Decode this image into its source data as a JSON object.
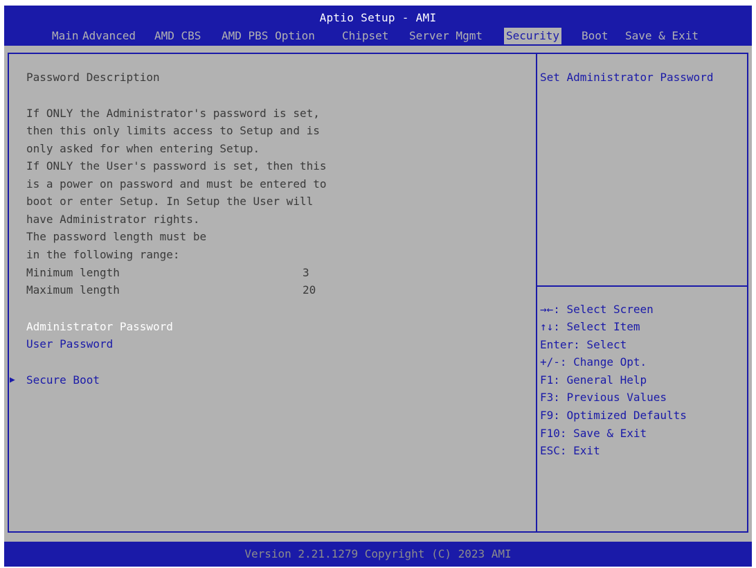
{
  "header": {
    "title": "Aptio Setup - AMI",
    "tabs": [
      {
        "label": "Main"
      },
      {
        "label": "Advanced"
      },
      {
        "label": "AMD CBS"
      },
      {
        "label": "AMD PBS Option"
      },
      {
        "label": "Chipset"
      },
      {
        "label": "Server Mgmt"
      },
      {
        "label": "Security",
        "active": true
      },
      {
        "label": "Boot"
      },
      {
        "label": "Save & Exit"
      }
    ]
  },
  "main": {
    "description_title": "Password Description",
    "description_lines": [
      "If ONLY the Administrator's password is set,",
      "then this only limits access to Setup and is",
      "only asked for when entering Setup.",
      "If ONLY the User's password is set, then this",
      "is a power on password and must be entered to",
      "boot or enter Setup. In Setup the User will",
      "have Administrator rights.",
      "The password length must be",
      "in the following range:"
    ],
    "min_length_label": "Minimum length",
    "min_length_value": "3",
    "max_length_label": "Maximum length",
    "max_length_value": "20",
    "items": [
      {
        "label": "Administrator Password",
        "selected": true
      },
      {
        "label": "User Password"
      },
      {
        "label": "Secure Boot",
        "submenu": true
      }
    ]
  },
  "help": {
    "item_help": "Set Administrator Password",
    "keys": [
      "→←: Select Screen",
      "↑↓: Select Item",
      "Enter: Select",
      "+/-: Change Opt.",
      "F1: General Help",
      "F3: Previous Values",
      "F9: Optimized Defaults",
      "F10: Save & Exit",
      "ESC: Exit"
    ]
  },
  "footer": {
    "version": "Version 2.21.1279 Copyright (C) 2023 AMI"
  },
  "colors": {
    "bar_blue": "#1a1aa8",
    "panel_gray": "#b2b2b2",
    "text_dark": "#3a3a3a",
    "highlight_white": "#ffffff"
  }
}
